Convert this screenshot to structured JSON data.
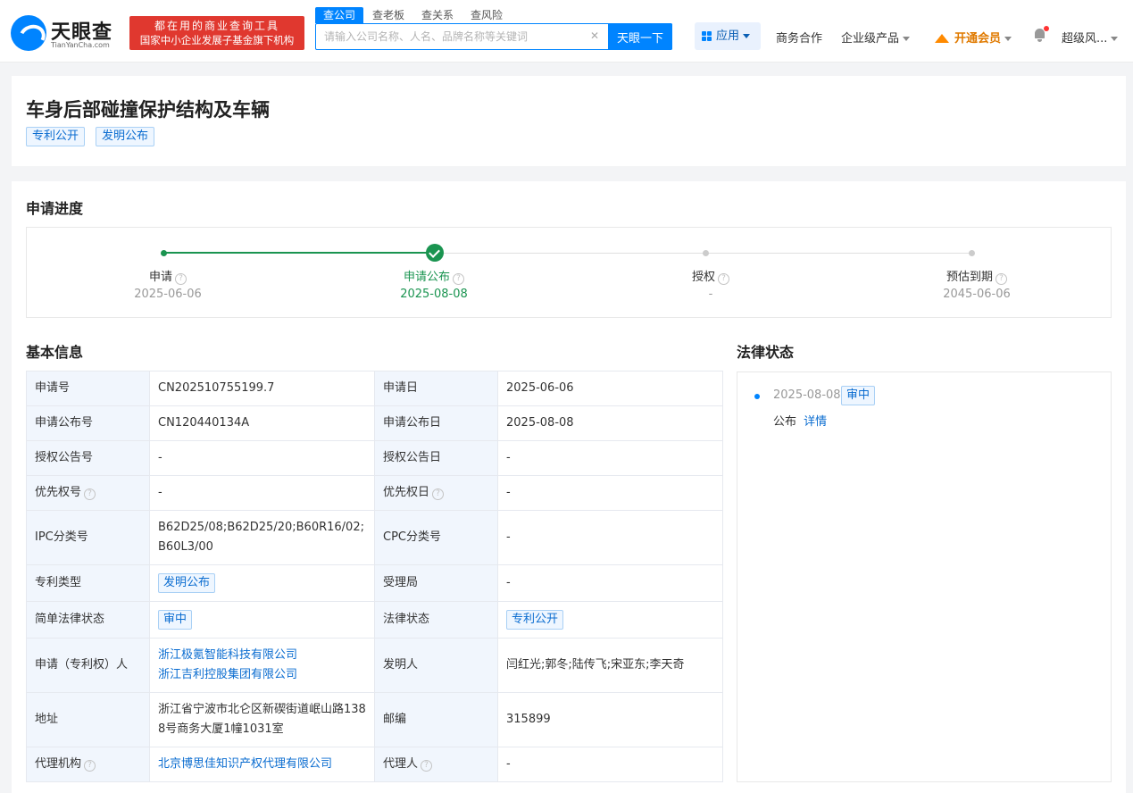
{
  "header": {
    "logo_name": "天眼查",
    "logo_domain": "TianYanCha.com",
    "slogan_line1": "都在用的商业查询工具",
    "slogan_line2": "国家中小企业发展子基金旗下机构",
    "search_tabs": [
      "查公司",
      "查老板",
      "查关系",
      "查风险"
    ],
    "search_placeholder": "请输入公司名称、人名、品牌名称等关键词",
    "search_button": "天眼一下",
    "nav": {
      "apps": "应用",
      "business": "商务合作",
      "enterprise": "企业级产品",
      "vip": "开通会员",
      "user": "超级风..."
    }
  },
  "patent": {
    "title": "车身后部碰撞保护结构及车辆",
    "tags": [
      "专利公开",
      "发明公布"
    ]
  },
  "progress": {
    "title": "申请进度",
    "steps": [
      {
        "label": "申请",
        "date": "2025-06-06"
      },
      {
        "label": "申请公布",
        "date": "2025-08-08"
      },
      {
        "label": "授权",
        "date": "-"
      },
      {
        "label": "预估到期",
        "date": "2045-06-06"
      }
    ],
    "current_step": 2
  },
  "basic_info": {
    "title": "基本信息",
    "rows": [
      {
        "k1": "申请号",
        "v1": "CN202510755199.7",
        "k2": "申请日",
        "v2": "2025-06-06"
      },
      {
        "k1": "申请公布号",
        "v1": "CN120440134A",
        "k2": "申请公布日",
        "v2": "2025-08-08"
      },
      {
        "k1": "授权公告号",
        "v1": "-",
        "k2": "授权公告日",
        "v2": "-"
      },
      {
        "k1": "优先权号",
        "v1": "-",
        "k2": "优先权日",
        "v2": "-"
      },
      {
        "k1": "IPC分类号",
        "v1": "B62D25/08;B62D25/20;B60R16/02;B60L3/00",
        "k2": "CPC分类号",
        "v2": "-"
      },
      {
        "k1": "专利类型",
        "v1": "发明公布",
        "k2": "受理局",
        "v2": "-"
      },
      {
        "k1": "简单法律状态",
        "v1": "审中",
        "k2": "法律状态",
        "v2": "专利公开"
      },
      {
        "k1": "申请（专利权）人",
        "v1a": "浙江极氪智能科技有限公司",
        "v1b": "浙江吉利控股集团有限公司",
        "k2": "发明人",
        "v2": "闫红光;郭冬;陆传飞;宋亚东;李天奇"
      },
      {
        "k1": "地址",
        "v1": "浙江省宁波市北仑区新碶街道岷山路1388号商务大厦1幢1031室",
        "k2": "邮编",
        "v2": "315899"
      },
      {
        "k1": "代理机构",
        "v1": "北京博思佳知识产权代理有限公司",
        "k2": "代理人",
        "v2": "-"
      }
    ]
  },
  "legal_status": {
    "title": "法律状态",
    "items": [
      {
        "date": "2025-08-08",
        "tag": "审中",
        "desc": "公布",
        "link": "详情"
      }
    ]
  }
}
